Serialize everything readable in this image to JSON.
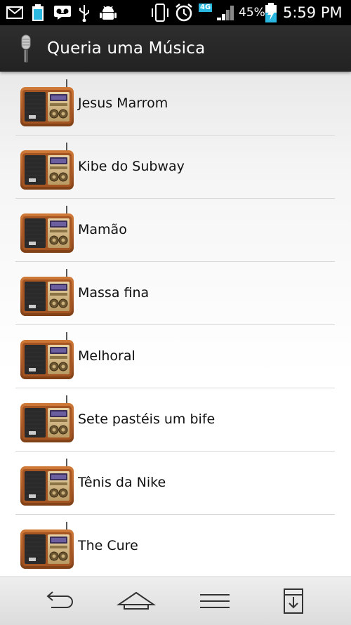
{
  "status_bar": {
    "network": "4G",
    "battery": "45%",
    "time": "5:59 PM"
  },
  "action_bar": {
    "title": "Queria uma Música",
    "icon": "microphone-icon"
  },
  "songs": [
    {
      "label": "Jesus Marrom",
      "icon": "radio-icon"
    },
    {
      "label": "Kibe do Subway",
      "icon": "radio-icon"
    },
    {
      "label": "Mamão",
      "icon": "radio-icon"
    },
    {
      "label": "Massa fina",
      "icon": "radio-icon"
    },
    {
      "label": "Melhoral",
      "icon": "radio-icon"
    },
    {
      "label": "Sete pastéis um bife",
      "icon": "radio-icon"
    },
    {
      "label": "Tênis da Nike",
      "icon": "radio-icon"
    },
    {
      "label": "The Cure",
      "icon": "radio-icon"
    }
  ],
  "nav_bar": {
    "buttons": [
      "back-icon",
      "home-icon",
      "menu-icon",
      "download-icon"
    ]
  },
  "colors": {
    "status_bg": "#000000",
    "action_bar_bg": "#2a2a2a",
    "battery_accent": "#33c5e8",
    "radio_wood": "#b5652a"
  }
}
